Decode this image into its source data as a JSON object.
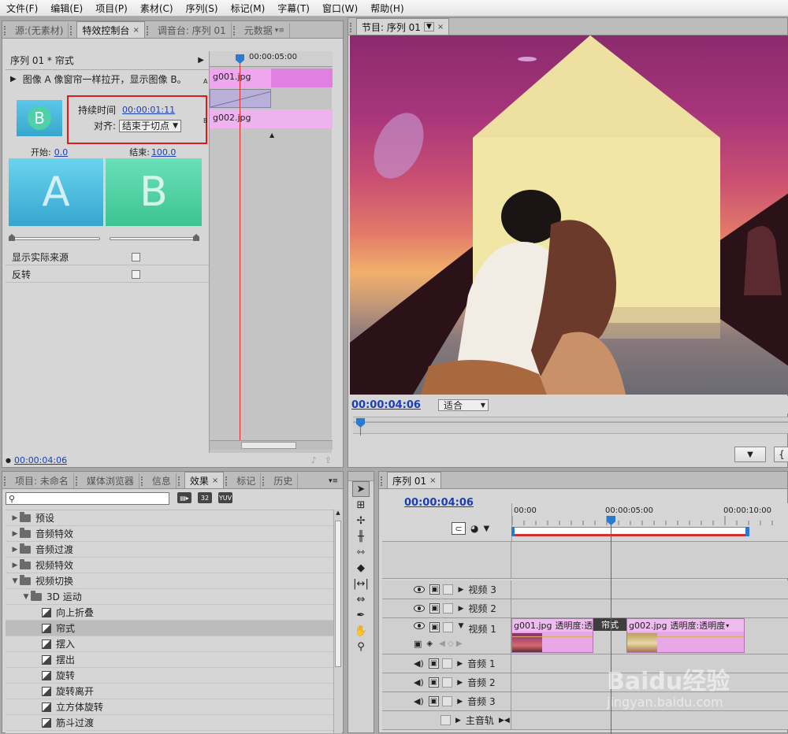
{
  "menu": [
    "文件(F)",
    "编辑(E)",
    "项目(P)",
    "素材(C)",
    "序列(S)",
    "标记(M)",
    "字幕(T)",
    "窗口(W)",
    "帮助(H)"
  ],
  "left_panel": {
    "tabs": [
      "源:(无素材)",
      "特效控制台",
      "调音台: 序列 01",
      "元数据"
    ],
    "sequence_label": "序列 01 * 帘式",
    "timecode_ruler": "00:00:05:00",
    "description": "图像 A 像窗帘一样拉开，显示图像 B。",
    "duration_label": "持续时间",
    "duration_value": "00:00:01:11",
    "align_label": "对齐:",
    "align_value": "结束于切点",
    "start_label": "开始:",
    "start_value": "0.0",
    "end_label": "结束:",
    "end_value": "100.0",
    "thumb_a": "A",
    "thumb_b": "B",
    "thumb_icon": "B",
    "show_actual_sources": "显示实际来源",
    "reverse": "反转",
    "clip_a": "g001.jpg",
    "clip_b": "g002.jpg",
    "track_a": "A",
    "track_b": "B",
    "timecode": "00:00:04:06"
  },
  "program": {
    "tab": "节目: 序列 01",
    "timecode": "00:00:04:06",
    "fit": "适合"
  },
  "project_panel": {
    "tabs": [
      "项目: 未命名",
      "媒体浏览器",
      "信息",
      "效果",
      "标记",
      "历史"
    ],
    "search_placeholder": "",
    "badges": [
      "32",
      "YUV"
    ],
    "tree": [
      {
        "label": "预设",
        "level": 0,
        "type": "folder",
        "expanded": false
      },
      {
        "label": "音频特效",
        "level": 0,
        "type": "folder",
        "expanded": false
      },
      {
        "label": "音频过渡",
        "level": 0,
        "type": "folder",
        "expanded": false
      },
      {
        "label": "视频特效",
        "level": 0,
        "type": "folder",
        "expanded": false
      },
      {
        "label": "视频切换",
        "level": 0,
        "type": "folder",
        "expanded": true
      },
      {
        "label": "3D 运动",
        "level": 1,
        "type": "folder",
        "expanded": true
      },
      {
        "label": "向上折叠",
        "level": 2,
        "type": "fx"
      },
      {
        "label": "帘式",
        "level": 2,
        "type": "fx",
        "selected": true
      },
      {
        "label": "摆入",
        "level": 2,
        "type": "fx"
      },
      {
        "label": "摆出",
        "level": 2,
        "type": "fx"
      },
      {
        "label": "旋转",
        "level": 2,
        "type": "fx"
      },
      {
        "label": "旋转离开",
        "level": 2,
        "type": "fx"
      },
      {
        "label": "立方体旋转",
        "level": 2,
        "type": "fx"
      },
      {
        "label": "筋斗过渡",
        "level": 2,
        "type": "fx"
      }
    ]
  },
  "timeline": {
    "tab": "序列 01",
    "timecode": "00:00:04:06",
    "ruler": [
      "00:00",
      "00:00:05:00",
      "00:00:10:00"
    ],
    "tracks": [
      {
        "label": "视频 3",
        "kind": "video"
      },
      {
        "label": "视频 2",
        "kind": "video"
      },
      {
        "label": "视频 1",
        "kind": "video",
        "expanded": true
      },
      {
        "label": "音频 1",
        "kind": "audio"
      },
      {
        "label": "音频 2",
        "kind": "audio"
      },
      {
        "label": "音频 3",
        "kind": "audio"
      },
      {
        "label": "主音轨",
        "kind": "master"
      }
    ],
    "clip1": "g001.jpg",
    "clip1_prop": "透明度:透明度",
    "transition": "帘式",
    "clip2": "g002.jpg",
    "clip2_prop": "透明度:透明度"
  },
  "watermark": {
    "brand": "Baidu经验",
    "url": "jingyan.baidu.com"
  },
  "colors": {
    "accent": "#1a3fb3",
    "clip_pink": "#e8a8e8",
    "playhead": "#e03030",
    "highlight_box": "#d91c1c"
  }
}
